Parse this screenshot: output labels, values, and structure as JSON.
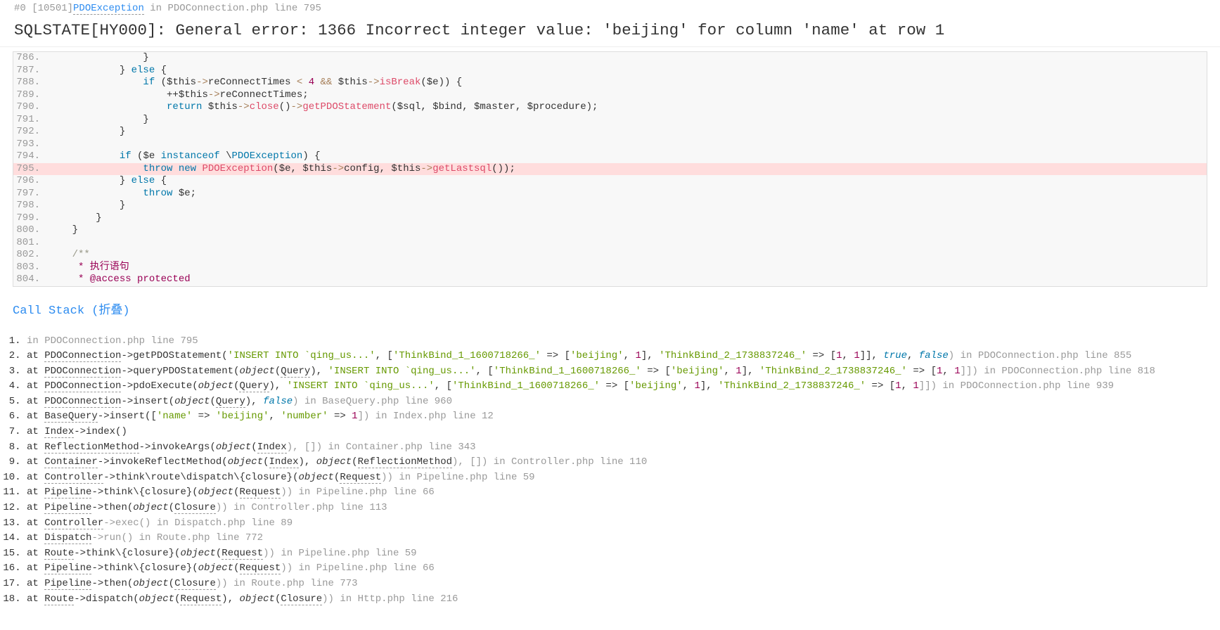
{
  "header": {
    "prefix": "#0",
    "bracket_code": "[10501]",
    "exception_link": "PDOException",
    "in": "in",
    "location": "PDOConnection.php line 795"
  },
  "error_title": "SQLSTATE[HY000]: General error: 1366 Incorrect integer value: 'beijing' for column 'name' at row 1",
  "code_lines": {
    "l786": "786.",
    "l787": "787.",
    "l788": "788.",
    "l789": "789.",
    "l790": "790.",
    "l791": "791.",
    "l792": "792.",
    "l793": "793.",
    "l794": "794.",
    "l795": "795.",
    "l796": "796.",
    "l797": "797.",
    "l798": "798.",
    "l799": "799.",
    "l800": "800.",
    "l801": "801.",
    "l802": "802.",
    "l803": "803.",
    "l804": "804."
  },
  "code": {
    "c786": "                }",
    "c787_a": "            } ",
    "c787_else": "else",
    "c787_b": " {",
    "c788_a": "                ",
    "c788_if": "if",
    "c788_b": " (",
    "c788_this": "$this",
    "c788_arrow": "->",
    "c788_prop": "reConnectTimes",
    "c788_lt": " < ",
    "c788_num": "4",
    "c788_and": " && ",
    "c788_this2": "$this",
    "c788_arrow2": "->",
    "c788_fn": "isBreak",
    "c788_paren": "(",
    "c788_e": "$e",
    "c788_end": ")) {",
    "c789_a": "                    ++",
    "c789_this": "$this",
    "c789_arrow": "->",
    "c789_prop": "reConnectTimes",
    "c789_semi": ";",
    "c790_a": "                    ",
    "c790_ret": "return",
    "c790_sp": " ",
    "c790_this": "$this",
    "c790_arrow": "->",
    "c790_close": "close",
    "c790_p1": "()",
    "c790_arrow2": "->",
    "c790_get": "getPDOStatement",
    "c790_p2": "(",
    "c790_sql": "$sql",
    "c790_c1": ", ",
    "c790_bind": "$bind",
    "c790_c2": ", ",
    "c790_master": "$master",
    "c790_c3": ", ",
    "c790_proc": "$procedure",
    "c790_end": ");",
    "c791": "                }",
    "c792": "            }",
    "c793": "",
    "c794_a": "            ",
    "c794_if": "if",
    "c794_b": " (",
    "c794_e": "$e",
    "c794_sp": " ",
    "c794_inst": "instanceof",
    "c794_sp2": " \\",
    "c794_cls": "PDOException",
    "c794_end": ") {",
    "c795_a": "                ",
    "c795_throw": "throw",
    "c795_sp": " ",
    "c795_new": "new",
    "c795_sp2": " ",
    "c795_cls": "PDOException",
    "c795_p": "(",
    "c795_e": "$e",
    "c795_c1": ", ",
    "c795_this": "$this",
    "c795_arrow": "->",
    "c795_cfg": "config",
    "c795_c2": ", ",
    "c795_this2": "$this",
    "c795_arrow2": "->",
    "c795_fn": "getLastsql",
    "c795_end": "());",
    "c796_a": "            } ",
    "c796_else": "else",
    "c796_b": " {",
    "c797_a": "                ",
    "c797_throw": "throw",
    "c797_sp": " ",
    "c797_e": "$e",
    "c797_semi": ";",
    "c798": "            }",
    "c799": "        }",
    "c800": "    }",
    "c801": "",
    "c802": "    /**",
    "c803": "     * 执行语句",
    "c804": "     * @access protected"
  },
  "call_stack": {
    "title": "Call Stack",
    "fold": " (折叠)"
  },
  "stack": {
    "s1_in": "in ",
    "s1_loc": "PDOConnection.php line 795",
    "s2_at": "at ",
    "s2_cls": "PDOConnection",
    "s2_m": "->getPDOStatement(",
    "s2_str1": "'INSERT INTO `qing_us...'",
    "s2_c1": ", [",
    "s2_str2": "'ThinkBind_1_1600718266_'",
    "s2_arr1": " => [",
    "s2_str3": "'beijing'",
    "s2_c2": ", ",
    "s2_n1": "1",
    "s2_b1": "], ",
    "s2_str4": "'ThinkBind_2_1738837246_'",
    "s2_arr2": " => [",
    "s2_n2": "1",
    "s2_c3": ", ",
    "s2_n3": "1",
    "s2_b2": "]], ",
    "s2_true": "true",
    "s2_c4": ", ",
    "s2_false": "false",
    "s2_end": ") in ",
    "s2_loc": "PDOConnection.php line 855",
    "s3_cls": "PDOConnection",
    "s3_m": "->queryPDOStatement(",
    "s3_obj": "object",
    "s3_p1": "(",
    "s3_q": "Query",
    "s3_p2": "), ",
    "s3_str1": "'INSERT INTO `qing_us...'",
    "s3_c1": ", [",
    "s3_str2": "'ThinkBind_1_1600718266_'",
    "s3_arr1": " => [",
    "s3_str3": "'beijing'",
    "s3_c2": ", ",
    "s3_n1": "1",
    "s3_b1": "], ",
    "s3_str4": "'ThinkBind_2_1738837246_'",
    "s3_arr2": " => [",
    "s3_n2": "1",
    "s3_c3": ", ",
    "s3_n3": "1",
    "s3_b2": "]]) in ",
    "s3_loc": "PDOConnection.php line 818",
    "s4_cls": "PDOConnection",
    "s4_m": "->pdoExecute(",
    "s4_q": "Query",
    "s4_p2": "), ",
    "s4_str1": "'INSERT INTO `qing_us...'",
    "s4_c1": ", [",
    "s4_str2": "'ThinkBind_1_1600718266_'",
    "s4_arr1": " => [",
    "s4_str3": "'beijing'",
    "s4_c2": ", ",
    "s4_n1": "1",
    "s4_b1": "], ",
    "s4_str4": "'ThinkBind_2_1738837246_'",
    "s4_arr2": " => [",
    "s4_n2": "1",
    "s4_c3": ", ",
    "s4_n3": "1",
    "s4_b2": "]]) in ",
    "s4_loc": "PDOConnection.php line 939",
    "s5_cls": "PDOConnection",
    "s5_m": "->insert(",
    "s5_q": "Query",
    "s5_p2": "), ",
    "s5_false": "false",
    "s5_end": ") in ",
    "s5_loc": "BaseQuery.php line 960",
    "s6_cls": "BaseQuery",
    "s6_m": "->insert([",
    "s6_k1": "'name'",
    "s6_arr1": " => ",
    "s6_v1": "'beijing'",
    "s6_c1": ", ",
    "s6_k2": "'number'",
    "s6_arr2": " => ",
    "s6_v2": "1",
    "s6_end": "]) in ",
    "s6_loc": "Index.php line 12",
    "s7_cls": "Index",
    "s7_m": "->index()",
    "s8_cls": "ReflectionMethod",
    "s8_m": "->invokeArgs(",
    "s8_q": "Index",
    "s8_p2": "), []) in ",
    "s8_loc": "Container.php line 343",
    "s9_cls": "Container",
    "s9_m": "->invokeReflectMethod(",
    "s9_q1": "Index",
    "s9_p2": "), ",
    "s9_q2": "ReflectionMethod",
    "s9_p3": "), []) in ",
    "s9_loc": "Controller.php line 110",
    "s10_cls": "Controller",
    "s10_m": "->think\\route\\dispatch\\{closure}(",
    "s10_q": "Request",
    "s10_end": ")) in ",
    "s10_loc": "Pipeline.php line 59",
    "s11_cls": "Pipeline",
    "s11_m": "->think\\{closure}(",
    "s11_q": "Request",
    "s11_end": ")) in ",
    "s11_loc": "Pipeline.php line 66",
    "s12_cls": "Pipeline",
    "s12_m": "->then(",
    "s12_q": "Closure",
    "s12_end": ")) in ",
    "s12_loc": "Controller.php line 113",
    "s13_cls": "Controller",
    "s13_m": "->exec() in ",
    "s13_loc": "Dispatch.php line 89",
    "s14_cls": "Dispatch",
    "s14_m": "->run() in ",
    "s14_loc": "Route.php line 772",
    "s15_cls": "Route",
    "s15_m": "->think\\{closure}(",
    "s15_q": "Request",
    "s15_end": ")) in ",
    "s15_loc": "Pipeline.php line 59",
    "s16_cls": "Pipeline",
    "s16_m": "->think\\{closure}(",
    "s16_q": "Request",
    "s16_end": ")) in ",
    "s16_loc": "Pipeline.php line 66",
    "s17_cls": "Pipeline",
    "s17_m": "->then(",
    "s17_q": "Closure",
    "s17_end": ")) in ",
    "s17_loc": "Route.php line 773",
    "s18_cls": "Route",
    "s18_m": "->dispatch(",
    "s18_q1": "Request",
    "s18_p2": "), ",
    "s18_q2": "Closure",
    "s18_end": ")) in ",
    "s18_loc": "Http.php line 216"
  }
}
